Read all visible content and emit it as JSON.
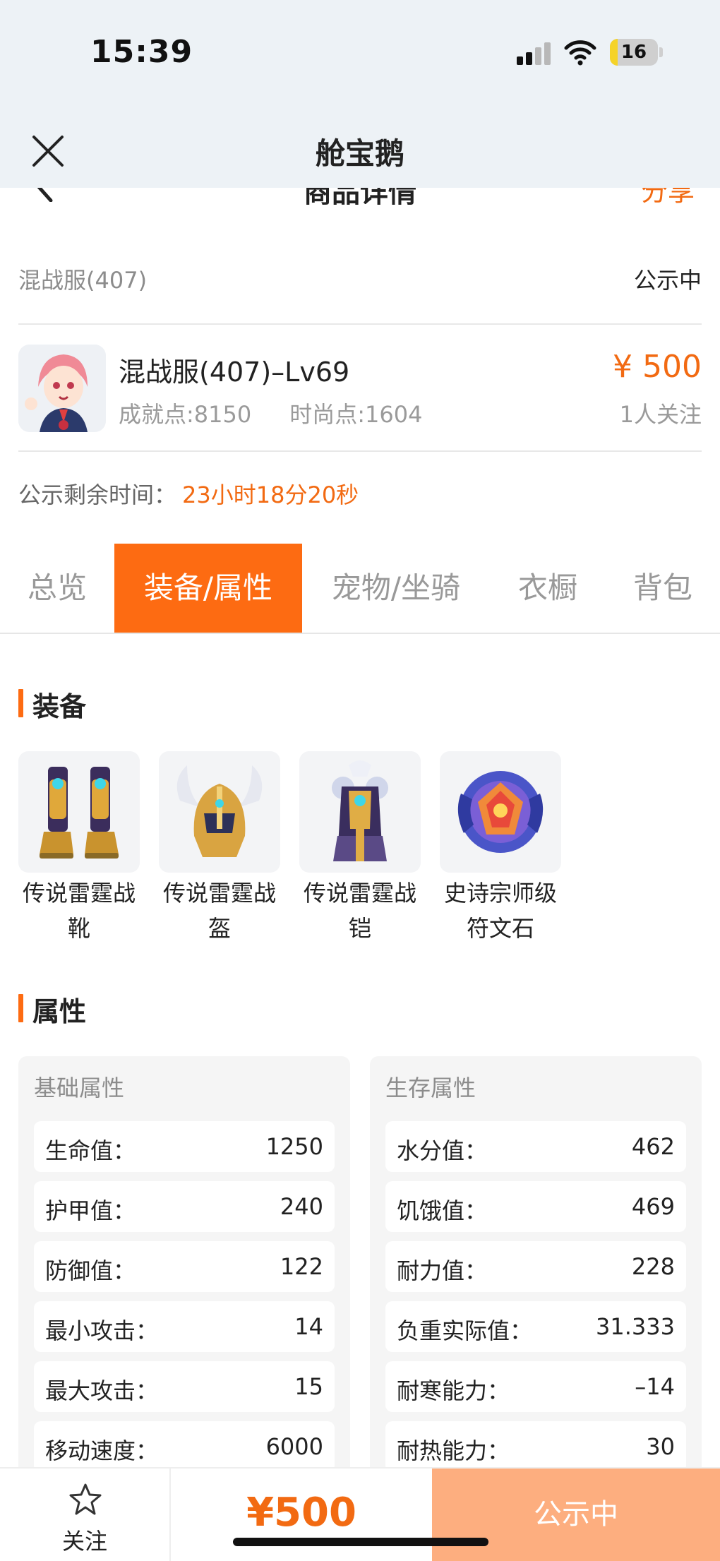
{
  "status_bar": {
    "time": "15:39",
    "battery": "16",
    "battery_level": 0.16
  },
  "nav": {
    "title": "舱宝鹅",
    "close_icon": "close-icon"
  },
  "sub_header": {
    "title": "商品详情",
    "share": "分享"
  },
  "product": {
    "server": "混战服(407)",
    "status": "公示中",
    "role_name": "混战服(407)–Lv69",
    "achievement": "成就点:8150",
    "fashion": "时尚点:1604",
    "price": "¥ 500",
    "followers": "1人关注",
    "remain_label": "公示剩余时间：",
    "remain_value": "23小时18分20秒"
  },
  "tabs": [
    {
      "label": "总览",
      "active": false
    },
    {
      "label": "装备/属性",
      "active": true
    },
    {
      "label": "宠物/坐骑",
      "active": false
    },
    {
      "label": "衣橱",
      "active": false
    },
    {
      "label": "背包",
      "active": false
    }
  ],
  "equipment": {
    "title": "装备",
    "items": [
      {
        "name": "传说雷霆战靴",
        "icon": "boots-icon"
      },
      {
        "name": "传说雷霆战盔",
        "icon": "helmet-icon"
      },
      {
        "name": "传说雷霆战铠",
        "icon": "armor-icon"
      },
      {
        "name": "史诗宗师级符文石",
        "icon": "rune-stone-icon"
      }
    ]
  },
  "attributes": {
    "title": "属性",
    "basic": {
      "title": "基础属性",
      "rows": [
        {
          "k": "生命值：",
          "v": "1250"
        },
        {
          "k": "护甲值：",
          "v": "240"
        },
        {
          "k": "防御值：",
          "v": "122"
        },
        {
          "k": "最小攻击：",
          "v": "14"
        },
        {
          "k": "最大攻击：",
          "v": "15"
        },
        {
          "k": "移动速度：",
          "v": "6000"
        }
      ]
    },
    "survival": {
      "title": "生存属性",
      "rows": [
        {
          "k": "水分值：",
          "v": "462"
        },
        {
          "k": "饥饿值：",
          "v": "469"
        },
        {
          "k": "耐力值：",
          "v": "228"
        },
        {
          "k": "负重实际值：",
          "v": "31.333"
        },
        {
          "k": "耐寒能力：",
          "v": "–14"
        },
        {
          "k": "耐热能力：",
          "v": "30"
        }
      ]
    }
  },
  "bottom_bar": {
    "follow_label": "关注",
    "price": "¥500",
    "status": "公示中"
  },
  "colors": {
    "accent": "#fd6b12",
    "price": "#f26a12",
    "status_button": "#fdae7f",
    "header_bg": "#edf2f6"
  }
}
